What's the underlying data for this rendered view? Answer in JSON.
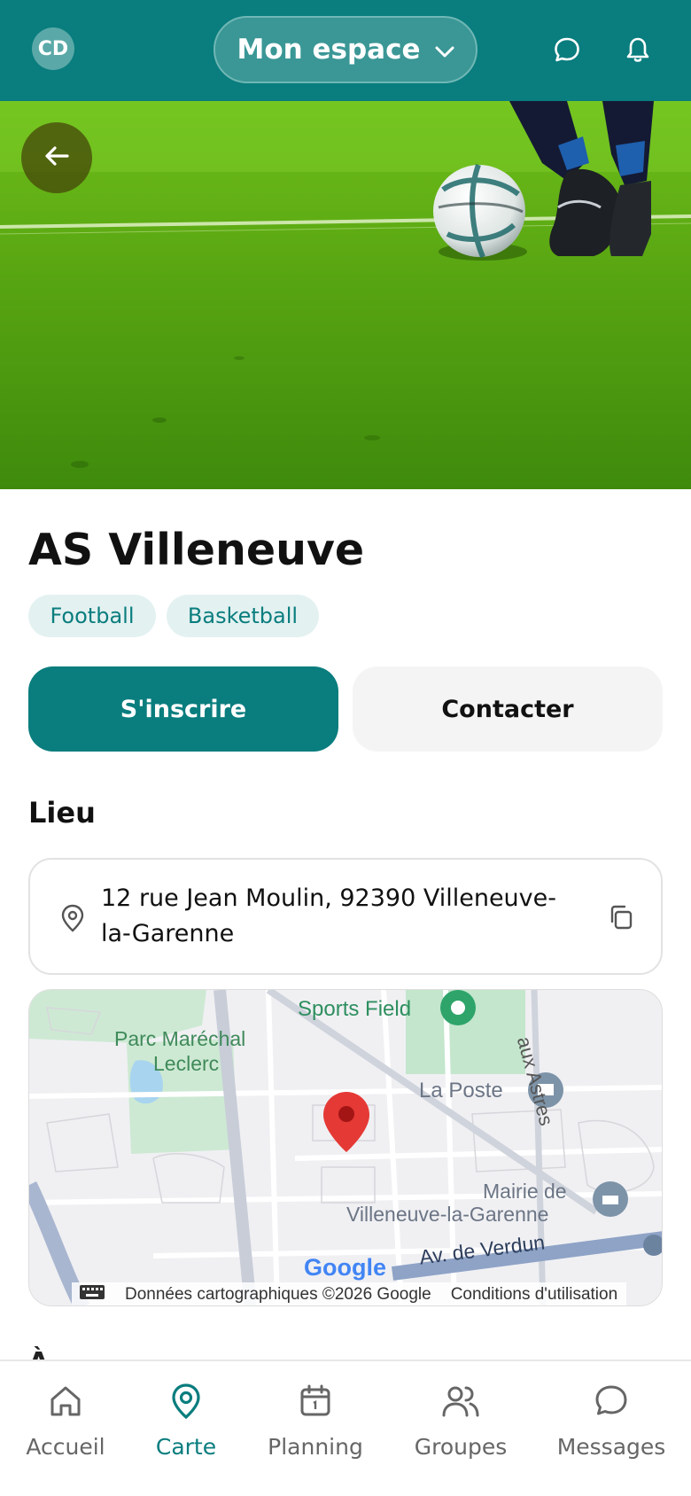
{
  "header": {
    "avatar_initials": "CD",
    "space_label": "Mon espace",
    "icons": [
      "chevron-down-icon",
      "chat-icon",
      "bell-icon"
    ]
  },
  "club": {
    "name": "AS Villeneuve",
    "tags": [
      "Football",
      "Basketball"
    ]
  },
  "actions": {
    "register_label": "S'inscrire",
    "contact_label": "Contacter"
  },
  "location": {
    "section_title": "Lieu",
    "address": "12 rue Jean Moulin, 92390 Villeneuve-la-Garenne"
  },
  "map": {
    "labels": {
      "sports_field": "Sports Field",
      "parc_line1": "Parc Maréchal",
      "parc_line2": "Leclerc",
      "la_poste": "La Poste",
      "mairie_line1": "Mairie de",
      "mairie_line2": "Villeneuve-la-Garenne",
      "avenue": "Av. de Verdun",
      "street": "aux Astres",
      "google": "Google"
    },
    "attribution": "Données cartographiques ©2026 Google",
    "terms": "Conditions d'utilisation"
  },
  "next_section_peek": "À",
  "bottom_nav": [
    {
      "label": "Accueil",
      "icon": "home-icon",
      "active": false
    },
    {
      "label": "Carte",
      "icon": "map-pin-icon",
      "active": true
    },
    {
      "label": "Planning",
      "icon": "calendar-icon",
      "active": false
    },
    {
      "label": "Groupes",
      "icon": "users-icon",
      "active": false
    },
    {
      "label": "Messages",
      "icon": "chat-icon",
      "active": false
    }
  ],
  "colors": {
    "brand": "#0a7d7e",
    "tag_bg": "#e4f1f1",
    "map_pin": "#e53935"
  }
}
